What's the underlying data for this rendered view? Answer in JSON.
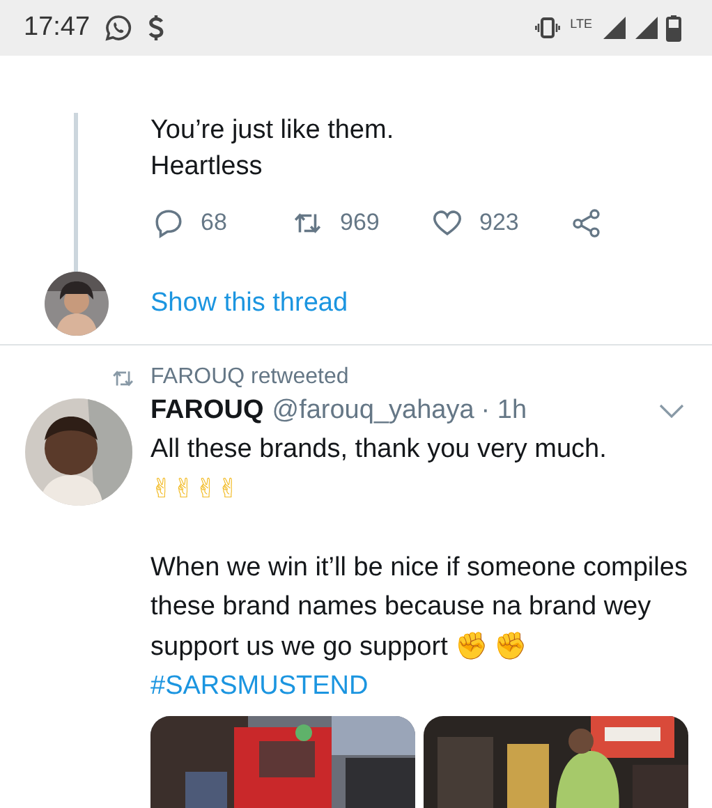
{
  "status_bar": {
    "time": "17:47",
    "network": "LTE"
  },
  "thread_tweet": {
    "lines": [
      "You’re just like them.",
      "Heartless"
    ],
    "actions": [
      {
        "kind": "reply",
        "count": "68"
      },
      {
        "kind": "retweet",
        "count": "969"
      },
      {
        "kind": "like",
        "count": "923"
      },
      {
        "kind": "share"
      }
    ],
    "show_thread": "Show this thread"
  },
  "retweet": {
    "label": "FAROUQ retweeted",
    "author": {
      "name": "FAROUQ",
      "handle": "@farouq_yahaya",
      "time": "· 1h"
    },
    "paragraphs": [
      [
        {
          "kind": "text",
          "text": "All these brands, thank you very much."
        },
        {
          "kind": "break"
        },
        {
          "kind": "peace",
          "text": "✌✌✌✌"
        }
      ],
      [
        {
          "kind": "text",
          "text": "When we win it’ll be nice if someone compiles these brand names because na brand wey support us we go support "
        },
        {
          "kind": "fist",
          "text": "✊"
        },
        {
          "kind": "fist",
          "text": "✊"
        },
        {
          "kind": "hashtag",
          "text": "#SARSMUSTEND"
        }
      ]
    ],
    "media": [
      {
        "kind": "picture"
      },
      {
        "kind": "picture"
      }
    ]
  }
}
